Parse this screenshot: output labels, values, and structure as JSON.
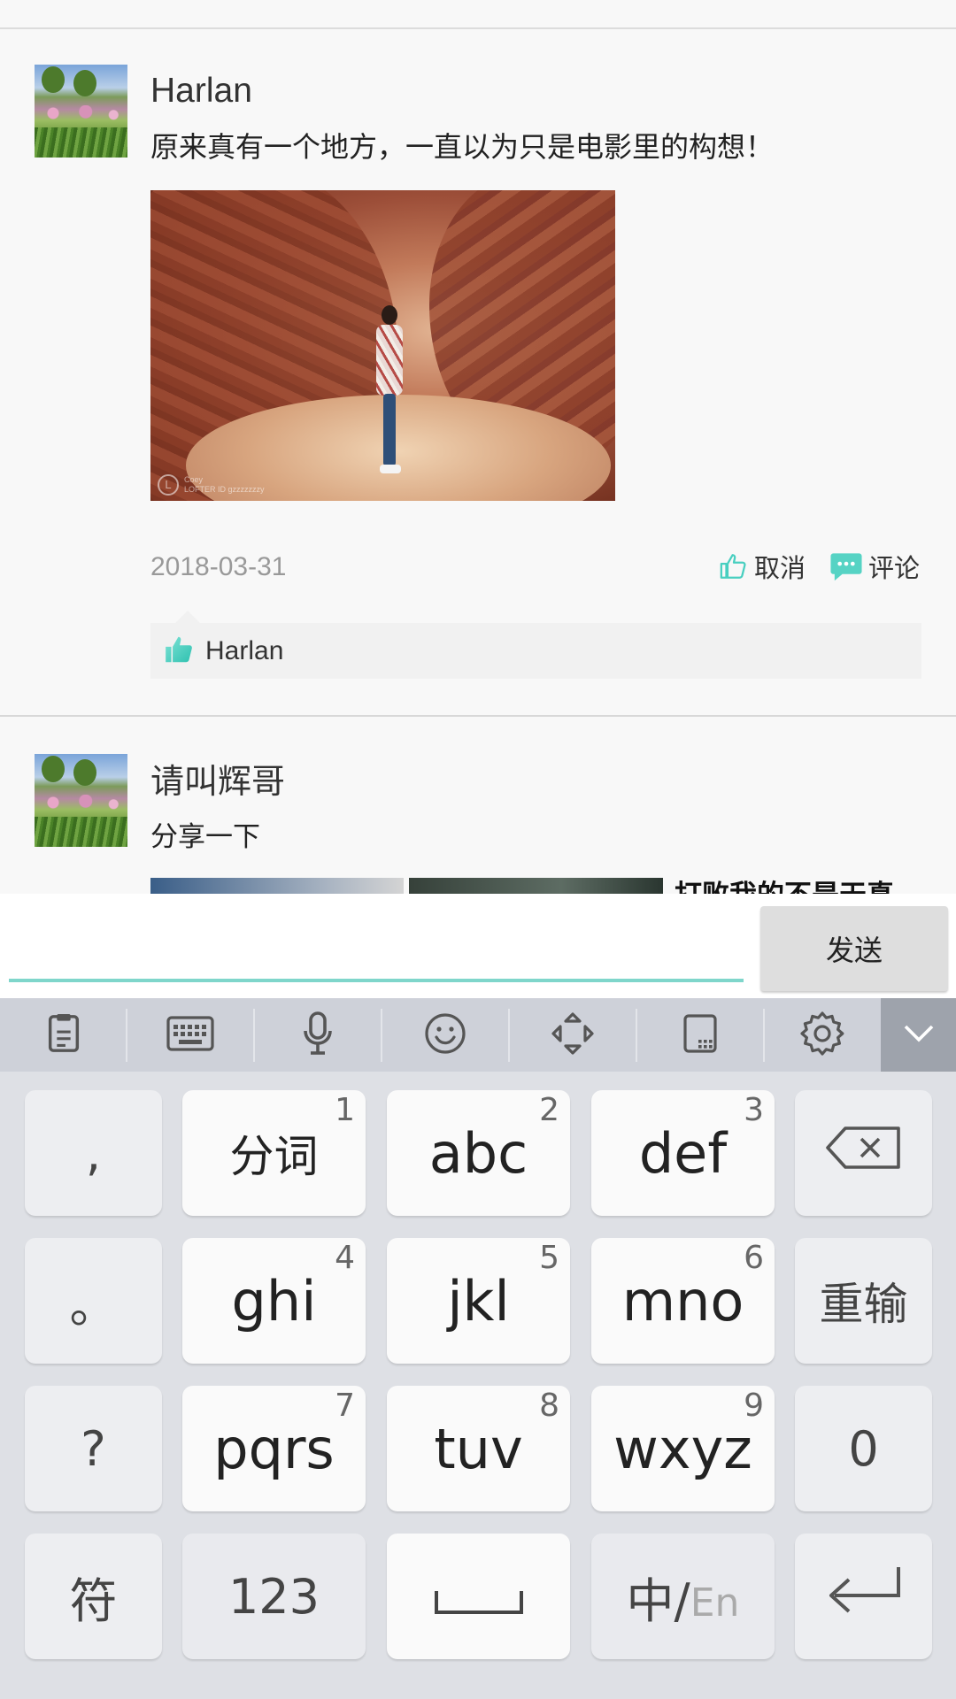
{
  "posts": [
    {
      "username": "Harlan",
      "text": "原来真有一个地方，一直以为只是电影里的构想！",
      "date": "2018-03-31",
      "photo_watermark": {
        "logo": "L",
        "line1": "Coey",
        "line2": "LOFTER ID gzzzzzzzy"
      },
      "like_action_label": "取消",
      "comment_action_label": "评论",
      "likers": "Harlan"
    },
    {
      "username": "请叫辉哥",
      "text": "分享一下",
      "preview_text": "打败我的不是天真"
    }
  ],
  "comment_bar": {
    "input_value": "",
    "send_label": "发送"
  },
  "keyboard": {
    "toolbar": [
      "clipboard-icon",
      "keyboard-icon",
      "microphone-icon",
      "emoji-icon",
      "move-cursor-icon",
      "handwriting-icon",
      "settings-icon",
      "chevron-down-icon"
    ],
    "left_column": [
      ",",
      "。",
      "?",
      "符"
    ],
    "keys": [
      {
        "label": "分词",
        "num": "1"
      },
      {
        "label": "abc",
        "num": "2"
      },
      {
        "label": "def",
        "num": "3"
      },
      {
        "label": "ghi",
        "num": "4"
      },
      {
        "label": "jkl",
        "num": "5"
      },
      {
        "label": "mno",
        "num": "6"
      },
      {
        "label": "pqrs",
        "num": "7"
      },
      {
        "label": "tuv",
        "num": "8"
      },
      {
        "label": "wxyz",
        "num": "9"
      }
    ],
    "right_column": [
      "backspace-icon",
      "重输",
      "0",
      "enter-icon"
    ],
    "bottom_row": {
      "numbers": "123",
      "space": "space-icon",
      "lang_main": "中/",
      "lang_sub": "En"
    }
  },
  "colors": {
    "accent": "#7fd6cb",
    "like_icon": "#48cfc0",
    "comment_icon": "#56d3c4"
  }
}
